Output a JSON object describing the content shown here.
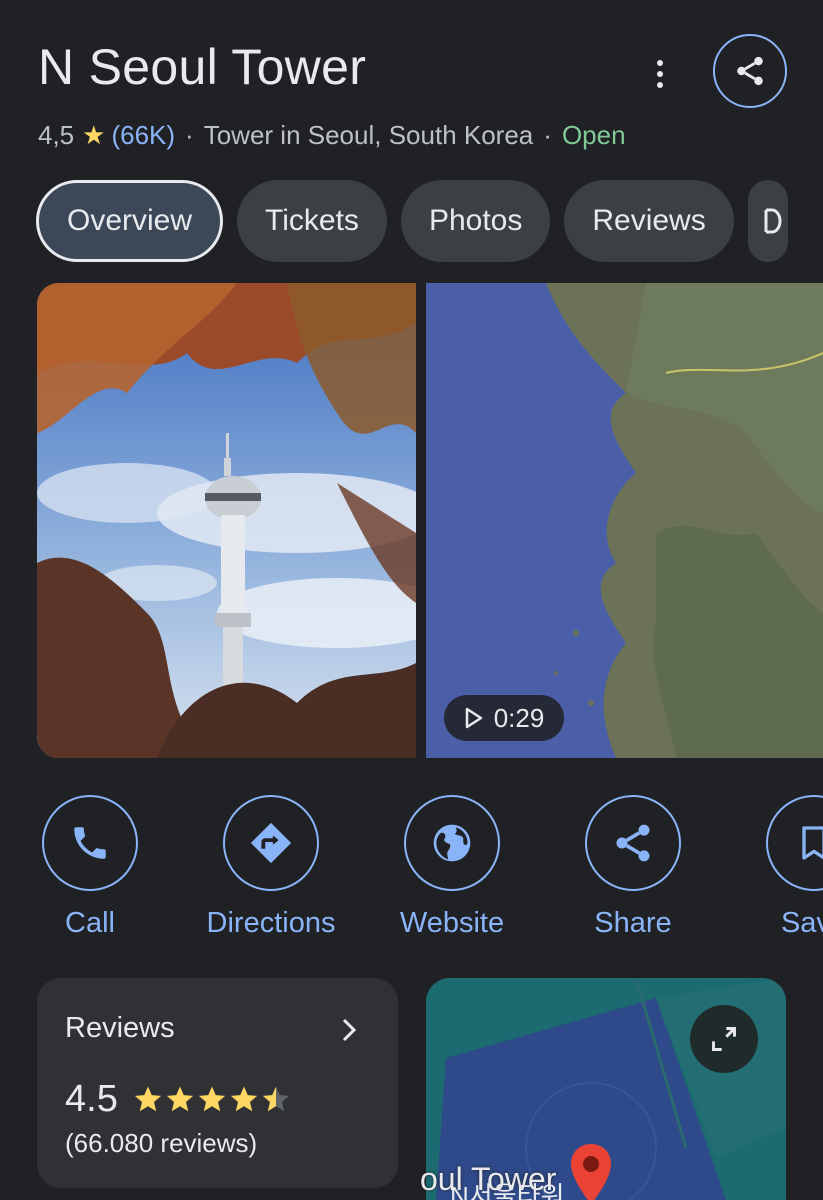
{
  "place": {
    "title": "N Seoul Tower",
    "rating": "4,5",
    "review_count": "(66K)",
    "category": "Tower in Seoul, South Korea",
    "status": "Open",
    "separator": "·"
  },
  "tabs": [
    {
      "label": "Overview",
      "active": true
    },
    {
      "label": "Tickets"
    },
    {
      "label": "Photos"
    },
    {
      "label": "Reviews"
    }
  ],
  "media": {
    "video_duration": "0:29"
  },
  "actions": [
    {
      "label": "Call",
      "icon": "phone-icon"
    },
    {
      "label": "Directions",
      "icon": "directions-icon"
    },
    {
      "label": "Website",
      "icon": "globe-icon"
    },
    {
      "label": "Share",
      "icon": "share-icon"
    },
    {
      "label": "Save",
      "icon": "bookmark-icon"
    }
  ],
  "reviews_card": {
    "title": "Reviews",
    "rating": "4.5",
    "count_text": "(66.080 reviews)",
    "stars_value": 4.5
  },
  "map_card": {
    "label": "oul Tower",
    "sublabel": "N서울타워"
  },
  "colors": {
    "background": "#202124",
    "accent": "#8ab4f8",
    "star": "#fdd663",
    "open": "#81c995"
  }
}
